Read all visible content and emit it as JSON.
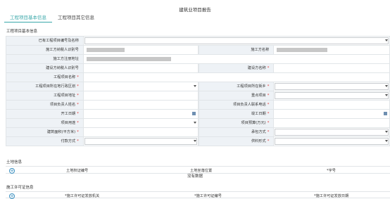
{
  "page_title": "建筑业项目报告",
  "tabs": [
    {
      "label": "工程项目基本信息",
      "active": true
    },
    {
      "label": "工程项目其它信息",
      "active": false
    }
  ],
  "section_basic": "工程项目基本信息",
  "fields": {
    "existing_project": "已有工程项目编号及名称",
    "contractor_tax_id": "施工方纳税人识别号",
    "contractor_name": "施工方名称",
    "contractor_address": "施工方注册地址",
    "builder_tax_id": "建设方纳税人识别号",
    "builder_name": "建设方名称",
    "project_name": "工程项目名称",
    "admin_region": "工程项目所在地行政区划",
    "street": "工程项目所在街乡",
    "project_address": "工程项目地址",
    "key_project": "重点项目",
    "manager_name": "项目负责人姓名",
    "manager_phone": "项目负责人联系电话",
    "start_date": "开工日期",
    "end_date": "竣工日期",
    "project_use": "项目用途",
    "budget": "项目预算(万元)",
    "building_area": "建筑面积(平方米)",
    "contract_mode": "承包方式",
    "payment_method": "付款方式",
    "material_form": "供料形式"
  },
  "required_mark": "*",
  "section_land": "土地信息",
  "land_columns": [
    "土地权证编号",
    "土地坐落位置",
    "*字号"
  ],
  "no_data": "没有数据",
  "section_permit": "施工许可证信息",
  "permit_columns": [
    "*施工许可证发放机关",
    "*施工许可证编号",
    "*施工许可证发放日期"
  ]
}
